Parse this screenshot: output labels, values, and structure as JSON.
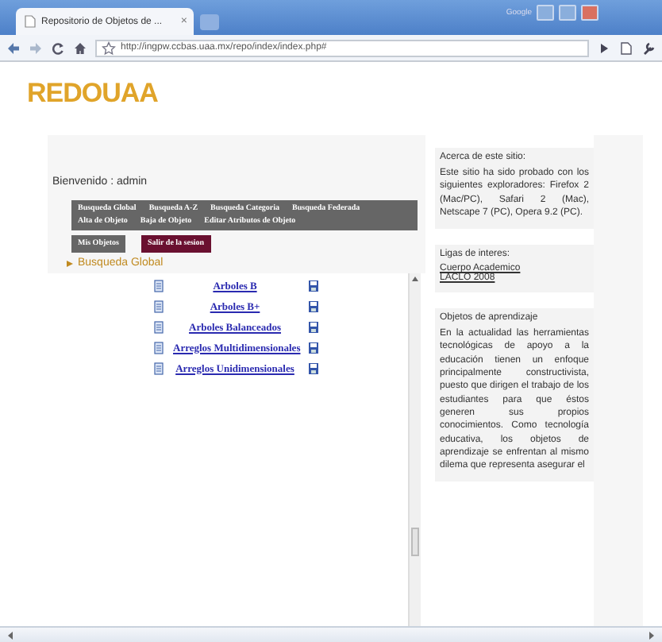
{
  "browser": {
    "corner_label": "Google",
    "tab": {
      "title": "Repositorio de Objetos de ...",
      "close": "×"
    },
    "address": "http://ingpw.ccbas.uaa.mx/repo/index/index.php#"
  },
  "site_title": "REDOUAA",
  "welcome": "Bienvenido : admin",
  "menu": [
    {
      "label": "Busqueda Global"
    },
    {
      "label": "Busqueda A-Z"
    },
    {
      "label": "Busqueda Categoria"
    },
    {
      "label": "Busqueda Federada"
    },
    {
      "label": "Alta de Objeto"
    },
    {
      "label": "Baja de Objeto"
    },
    {
      "label": "Editar Atributos de Objeto"
    }
  ],
  "session_buttons": [
    {
      "label": "Mis Objetos",
      "kind": "plain"
    },
    {
      "label": "Salir de la sesion",
      "kind": "exit"
    }
  ],
  "breadcrumb": "Busqueda Global",
  "results": [
    {
      "name": "Arboles B"
    },
    {
      "name": "Arboles B+"
    },
    {
      "name": "Arboles Balanceados"
    },
    {
      "name": "Arreglos Multidimensionales"
    },
    {
      "name": "Arreglos Unidimensionales"
    }
  ],
  "sidebar": [
    {
      "kind": "text",
      "heading": "Acerca de este sitio:",
      "body": "Este sitio ha sido probado con los siguientes exploradores: Firefox 2 (Mac/PC), Safari 2 (Mac), Netscape 7 (PC), Opera 9.2 (PC)."
    },
    {
      "kind": "links",
      "heading": "Ligas de interes:",
      "links": [
        "Cuerpo Academico",
        "LACLO 2008"
      ]
    },
    {
      "kind": "text",
      "heading": "Objetos de aprendizaje",
      "body": "En la actualidad las herramientas tecnológicas de apoyo a la educación tienen un enfoque principalmente constructivista, puesto que dirigen el trabajo de los estudiantes para que éstos generen sus propios conocimientos. Como tecnología educativa, los objetos de aprendizaje se enfrentan al mismo dilema que representa asegurar el"
    }
  ]
}
